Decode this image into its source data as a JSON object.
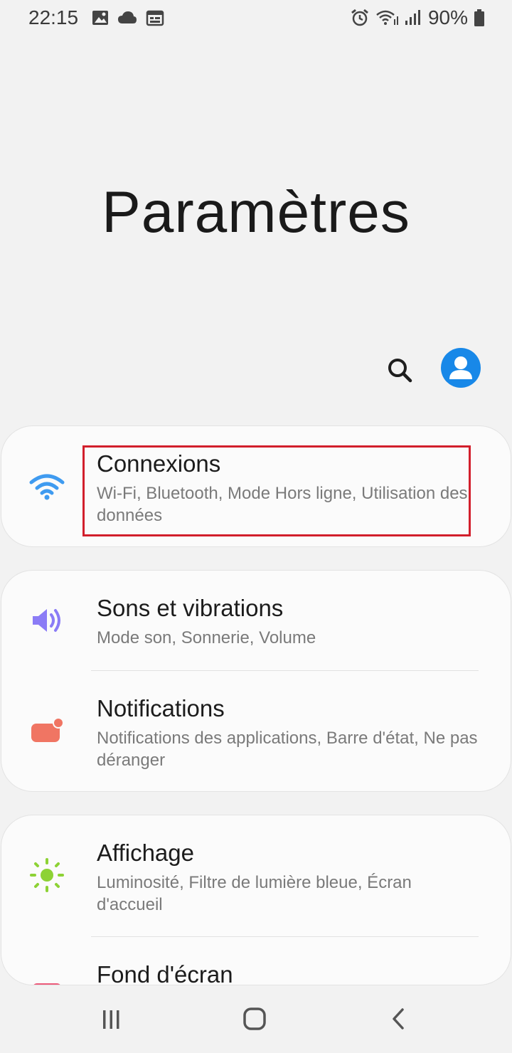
{
  "status": {
    "time": "22:15",
    "battery": "90%"
  },
  "header": {
    "title": "Paramètres"
  },
  "colors": {
    "accent": "#1888e8",
    "wifi_icon": "#3f9bf0",
    "sound_icon": "#8b7cf6",
    "notif_icon": "#f07563",
    "display_icon": "#8dd235",
    "highlight": "#d21f2c"
  },
  "settings": [
    {
      "title": "Connexions",
      "subtitle": "Wi-Fi, Bluetooth, Mode Hors ligne, Utilisation des données",
      "icon": "wifi-icon"
    },
    {
      "title": "Sons et vibrations",
      "subtitle": "Mode son, Sonnerie, Volume",
      "icon": "sound-icon"
    },
    {
      "title": "Notifications",
      "subtitle": "Notifications des applications, Barre d'état, Ne pas déranger",
      "icon": "notification-icon"
    },
    {
      "title": "Affichage",
      "subtitle": "Luminosité, Filtre de lumière bleue, Écran d'accueil",
      "icon": "brightness-icon"
    },
    {
      "title": "Fond d'écran",
      "icon": "wallpaper-icon"
    }
  ]
}
